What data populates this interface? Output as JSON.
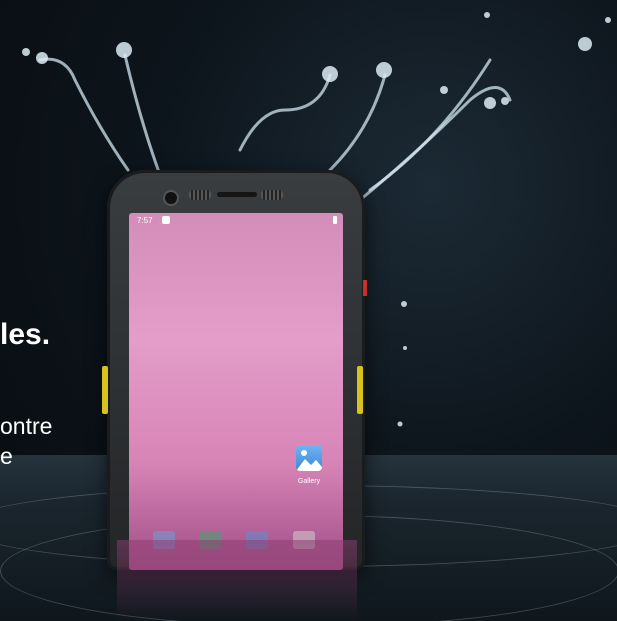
{
  "caption": {
    "line1": "les.",
    "line2": "ontre",
    "line3": "e"
  },
  "phone": {
    "status_time": "7:57",
    "apps": [
      {
        "label": "Gallery",
        "icon": "gallery-icon"
      }
    ]
  },
  "colors": {
    "background": "#0b1117",
    "screen_pink": "#e49dc8",
    "side_button": "#d8c21e",
    "text": "#ffffff"
  }
}
